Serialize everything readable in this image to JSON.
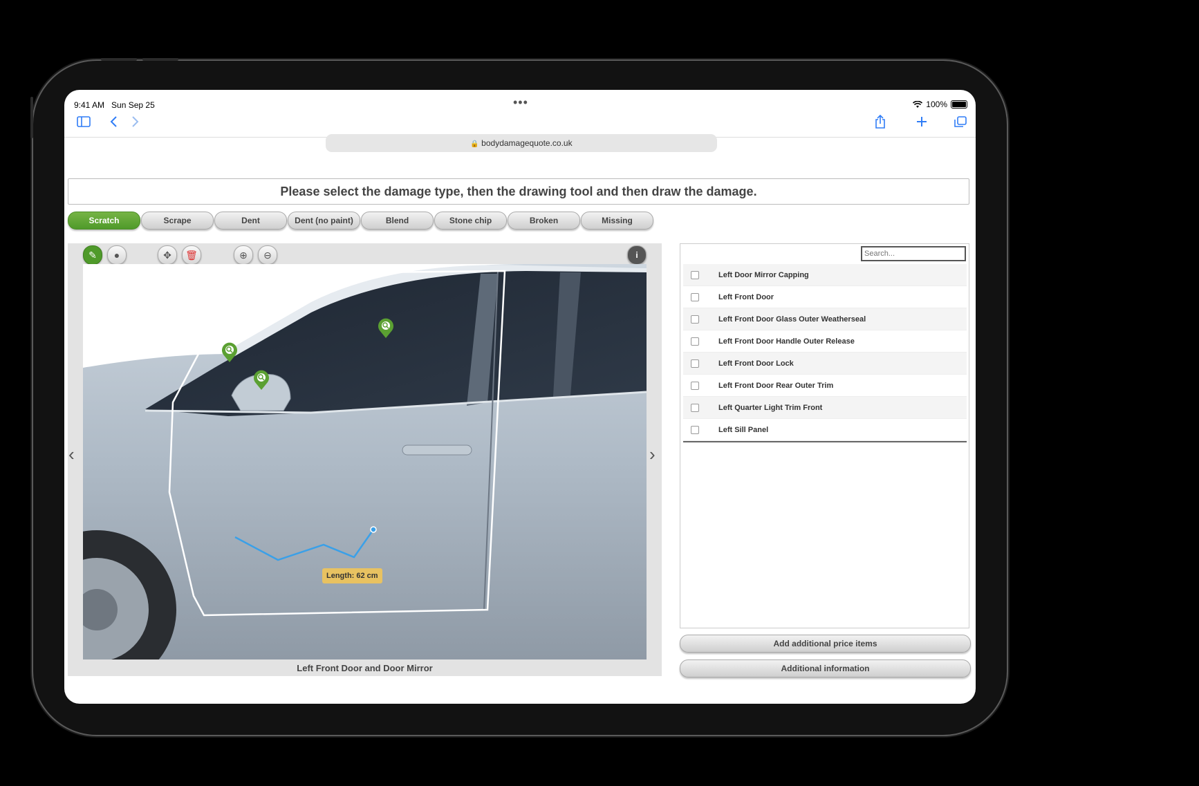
{
  "status": {
    "time": "9:41 AM",
    "date": "Sun Sep 25",
    "dots": "•••",
    "battery": "100%"
  },
  "browser": {
    "url": "bodydamagequote.co.uk",
    "lock_icon": "lock-icon"
  },
  "instruction": "Please select the damage type, then the drawing tool and then draw the damage.",
  "damage_types": [
    "Scratch",
    "Scrape",
    "Dent",
    "Dent (no paint)",
    "Blend",
    "Stone chip",
    "Broken",
    "Missing"
  ],
  "active_type": "Scratch",
  "viewer": {
    "caption": "Left Front Door and Door Mirror",
    "measurement": "Length: 62 cm"
  },
  "search": {
    "placeholder": "Search..."
  },
  "parts": [
    "Left Door Mirror Capping",
    "Left Front Door",
    "Left Front Door Glass Outer Weatherseal",
    "Left Front Door Handle Outer Release",
    "Left Front Door Lock",
    "Left Front Door Rear Outer Trim",
    "Left Quarter Light Trim Front",
    "Left Sill Panel"
  ],
  "buttons": {
    "add_items": "Add additional price items",
    "additional_info": "Additional information"
  },
  "colors": {
    "accent_green": "#4f9a2a",
    "browser_blue": "#2f7cf6",
    "label_yellow": "#e8c261",
    "scratch_line": "#3aa0e8"
  }
}
